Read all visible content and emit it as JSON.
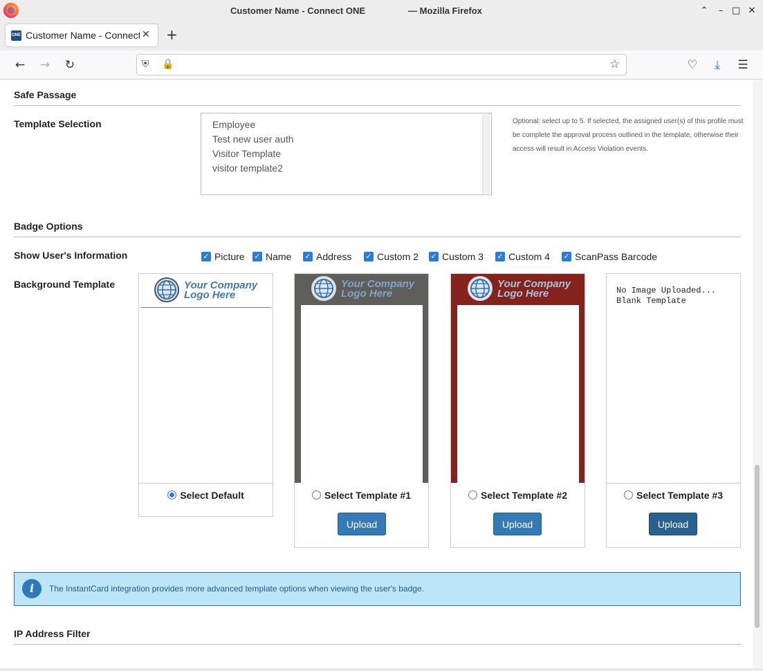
{
  "window": {
    "title_left": "Customer Name - Connect ONE",
    "title_right": "— Mozilla Firefox"
  },
  "tab": {
    "favicon_text": "ONE",
    "title": "Customer Name - Connect ONE"
  },
  "urlbar": {
    "value": ""
  },
  "sections": {
    "safe_passage": "Safe Passage",
    "badge_options": "Badge Options",
    "ip_filter": "IP Address Filter"
  },
  "template_selection": {
    "label": "Template Selection",
    "options": [
      "Employee",
      "Test new user auth",
      "Visitor Template",
      "visitor template2"
    ],
    "help_text": "Optional: select up to 5. If selected, the assigned user(s) of this profile must be complete the approval process outlined in the template, otherwise their access will result in Access Violation events."
  },
  "show_user_info": {
    "label": "Show User's Information",
    "checkboxes": [
      {
        "label": "Picture",
        "checked": true
      },
      {
        "label": "Name",
        "checked": true
      },
      {
        "label": "Address",
        "checked": true
      },
      {
        "label": "Custom 2",
        "checked": true
      },
      {
        "label": "Custom 3",
        "checked": true
      },
      {
        "label": "Custom 4",
        "checked": true
      },
      {
        "label": "ScanPass Barcode",
        "checked": true
      }
    ]
  },
  "background_template": {
    "label": "Background Template",
    "logo_line1": "Your Company",
    "logo_line2": "Logo Here",
    "no_image_line1": "No Image Uploaded...",
    "no_image_line2": "Blank Template",
    "cards": [
      {
        "radio_label": "Select Default",
        "selected": true,
        "frame_color": "#ffffff"
      },
      {
        "radio_label": "Select Template #1",
        "selected": false,
        "frame_color": "#5f5e5b",
        "upload_label": "Upload"
      },
      {
        "radio_label": "Select Template #2",
        "selected": false,
        "frame_color": "#84231c",
        "upload_label": "Upload"
      },
      {
        "radio_label": "Select Template #3",
        "selected": false,
        "frame_color": "#ffffff",
        "upload_label": "Upload"
      }
    ]
  },
  "info_alert": {
    "icon": "info-icon",
    "text": "The InstantCard integration provides more advanced template options when viewing the user's badge."
  },
  "colors": {
    "accent": "#2b7bdc",
    "button": "#337ab7",
    "alert_bg": "#bde5f8",
    "alert_text": "#1f5c8c"
  }
}
